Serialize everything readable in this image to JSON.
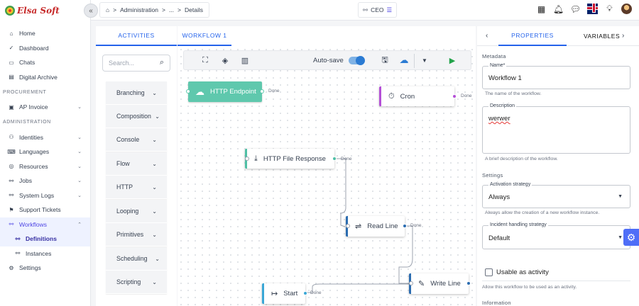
{
  "brand": {
    "name": "Elsa Soft"
  },
  "sidebar": {
    "items": [
      {
        "label": "Home",
        "icon": "home-icon"
      },
      {
        "label": "Dashboard",
        "icon": "dashboard-icon"
      },
      {
        "label": "Chats",
        "icon": "chat-icon"
      },
      {
        "label": "Digital Archive",
        "icon": "archive-icon"
      }
    ],
    "section_procurement": "PROCUREMENT",
    "ap_invoice": "AP Invoice",
    "section_administration": "ADMINISTRATION",
    "admin_items": [
      {
        "label": "Identities"
      },
      {
        "label": "Languages"
      },
      {
        "label": "Resources"
      },
      {
        "label": "Jobs"
      },
      {
        "label": "System Logs"
      },
      {
        "label": "Support Tickets"
      }
    ],
    "workflows": "Workflows",
    "definitions": "Definitions",
    "instances": "Instances",
    "settings": "Settings"
  },
  "topbar": {
    "breadcrumb": {
      "home_icon": "home-icon",
      "sep": ">",
      "part1": "Administration",
      "part2": "...",
      "part3": "Details"
    },
    "role": "CEO"
  },
  "activities": {
    "tab": "ACTIVITIES",
    "search_placeholder": "Search...",
    "categories": [
      "Branching",
      "Composition",
      "Console",
      "Flow",
      "HTTP",
      "Looping",
      "Primitives",
      "Scheduling",
      "Scripting"
    ]
  },
  "workflow": {
    "tab": "WORKFLOW 1",
    "autosave_label": "Auto-save",
    "autosave_on": true,
    "nodes": {
      "http_endpoint": "HTTP Endpoint",
      "cron": "Cron",
      "http_file_response": "HTTP File Response",
      "read_line": "Read Line",
      "write_line": "Write Line",
      "start": "Start"
    },
    "done_label": "Done",
    "colors": {
      "http_endpoint_bg": "#5fc8ad",
      "cron_accent": "#b44fd6",
      "http_file_accent": "#4fbfa5",
      "read_line_accent": "#2b6cb0",
      "write_line_accent": "#2b6cb0",
      "start_accent": "#3aa7d6"
    }
  },
  "properties": {
    "tab_active": "PROPERTIES",
    "tab_other": "VARIABLES",
    "metadata_title": "Metadata",
    "name_label": "Name*",
    "name_value": "Workflow 1",
    "name_helper": "The name of the workflow.",
    "description_label": "Description",
    "description_value": "werwer",
    "description_helper": "A brief description of the workflow.",
    "settings_title": "Settings",
    "activation_label": "Activation strategy",
    "activation_value": "Always",
    "activation_helper": "Always allow the creation of a new workflow instance.",
    "incident_label": "Incident handling strategy",
    "incident_value": "Default",
    "usable_label": "Usable as activity",
    "usable_checked": false,
    "usable_helper": "Allow this workflow to be used as an activity.",
    "information_title": "Information"
  }
}
